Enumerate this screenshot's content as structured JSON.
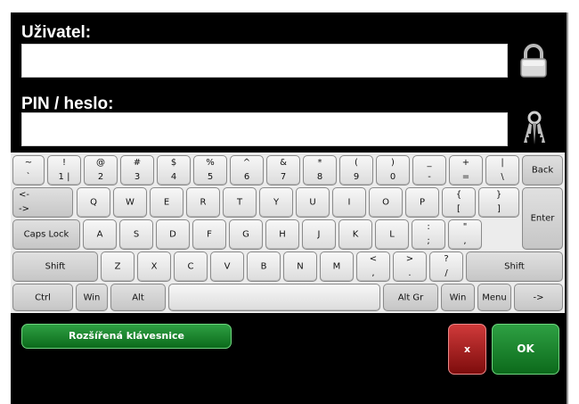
{
  "login": {
    "user_label": "Uživatel:",
    "user_value": "",
    "pin_label": "PIN / heslo:",
    "pin_value": ""
  },
  "icons": {
    "user_field_icon": "padlock-icon",
    "pin_field_icon": "keys-icon"
  },
  "keyboard": {
    "row1": [
      {
        "top": "~",
        "bottom": "`"
      },
      {
        "top": "!",
        "bottom": "1 |"
      },
      {
        "top": "@",
        "bottom": "2"
      },
      {
        "top": "#",
        "bottom": "3"
      },
      {
        "top": "$",
        "bottom": "4"
      },
      {
        "top": "%",
        "bottom": "5"
      },
      {
        "top": "^",
        "bottom": "6"
      },
      {
        "top": "&",
        "bottom": "7"
      },
      {
        "top": "*",
        "bottom": "8"
      },
      {
        "top": "(",
        "bottom": "9"
      },
      {
        "top": ")",
        "bottom": "0"
      },
      {
        "top": "_",
        "bottom": "-"
      },
      {
        "top": "+",
        "bottom": "="
      },
      {
        "top": "|",
        "bottom": "\\"
      }
    ],
    "back": "Back",
    "tab_top": "<-",
    "tab_bottom": "->",
    "row2": [
      "Q",
      "W",
      "E",
      "R",
      "T",
      "Y",
      "U",
      "I",
      "O",
      "P"
    ],
    "row2_extra": [
      {
        "top": "{",
        "bottom": "["
      },
      {
        "top": "}",
        "bottom": "]"
      }
    ],
    "enter": "Enter",
    "caps": "Caps Lock",
    "row3": [
      "A",
      "S",
      "D",
      "F",
      "G",
      "H",
      "J",
      "K",
      "L"
    ],
    "row3_extra": [
      {
        "top": ":",
        "bottom": ";"
      },
      {
        "top": "\"",
        "bottom": ","
      }
    ],
    "shift_left": "Shift",
    "row4": [
      "Z",
      "X",
      "C",
      "V",
      "B",
      "N",
      "M"
    ],
    "row4_extra": [
      {
        "top": "<",
        "bottom": ","
      },
      {
        "top": ">",
        "bottom": "."
      },
      {
        "top": "?",
        "bottom": "/"
      }
    ],
    "shift_right": "Shift",
    "ctrl": "Ctrl",
    "win_left": "Win",
    "alt": "Alt",
    "alt_gr": "Alt Gr",
    "win_right": "Win",
    "menu": "Menu",
    "arrow": "->"
  },
  "buttons": {
    "extended_keyboard": "Rozšířená klávesnice",
    "cancel": "x",
    "ok": "OK"
  },
  "colors": {
    "background": "#000000",
    "green_button": "#1a8a2e",
    "red_button": "#a01c1c"
  }
}
